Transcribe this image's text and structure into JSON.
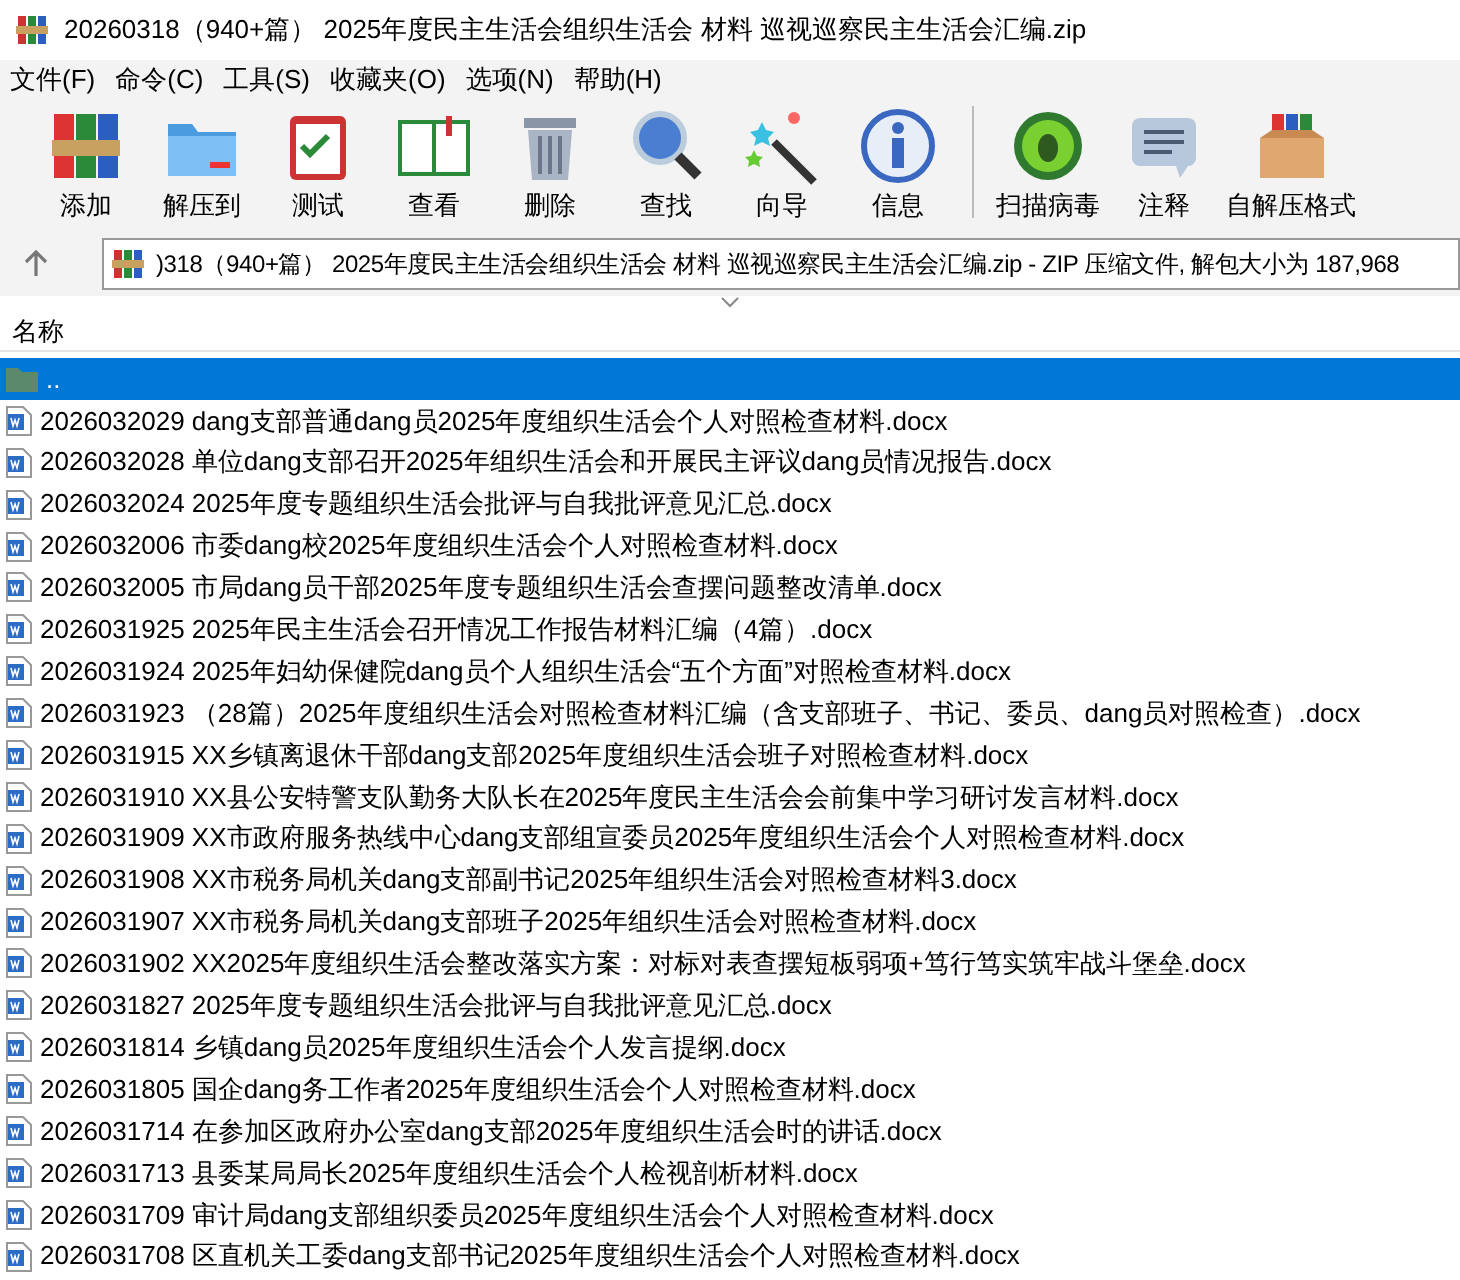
{
  "window": {
    "title": "20260318（940+篇） 2025年度民主生活会组织生活会 材料   巡视巡察民主生活会汇编.zip"
  },
  "menu": [
    "文件(F)",
    "命令(C)",
    "工具(S)",
    "收藏夹(O)",
    "选项(N)",
    "帮助(H)"
  ],
  "toolbar": [
    {
      "kind": "add",
      "label": "添加"
    },
    {
      "kind": "extract",
      "label": "解压到"
    },
    {
      "kind": "test",
      "label": "测试"
    },
    {
      "kind": "view",
      "label": "查看"
    },
    {
      "kind": "delete",
      "label": "删除"
    },
    {
      "kind": "find",
      "label": "查找"
    },
    {
      "kind": "wizard",
      "label": "向导"
    },
    {
      "kind": "info",
      "label": "信息"
    },
    {
      "kind": "separator"
    },
    {
      "kind": "scan",
      "label": "扫描病毒"
    },
    {
      "kind": "comment",
      "label": "注释"
    },
    {
      "kind": "sfx",
      "label": "自解压格式"
    }
  ],
  "address": {
    "text": ")318（940+篇） 2025年度民主生活会组织生活会 材料   巡视巡察民主生活会汇编.zip - ZIP 压缩文件, 解包大小为 187,968"
  },
  "table": {
    "columns": [
      "名称"
    ],
    "rows": [
      {
        "kind": "parent",
        "name": "..",
        "selected": true
      },
      {
        "kind": "docx",
        "name": "2026032029 dang支部普通dang员2025年度组织生活会个人对照检查材料.docx",
        "selected": false
      },
      {
        "kind": "docx",
        "name": "2026032028 单位dang支部召开2025年组织生活会和开展民主评议dang员情况报告.docx",
        "selected": false
      },
      {
        "kind": "docx",
        "name": "2026032024 2025年度专题组织生活会批评与自我批评意见汇总.docx",
        "selected": false
      },
      {
        "kind": "docx",
        "name": "2026032006 市委dang校2025年度组织生活会个人对照检查材料.docx",
        "selected": false
      },
      {
        "kind": "docx",
        "name": "2026032005 市局dang员干部2025年度专题组织生活会查摆问题整改清单.docx",
        "selected": false
      },
      {
        "kind": "docx",
        "name": "2026031925 2025年民主生活会召开情况工作报告材料汇编（4篇）.docx",
        "selected": false
      },
      {
        "kind": "docx",
        "name": "2026031924 2025年妇幼保健院dang员个人组织生活会“五个方面”对照检查材料.docx",
        "selected": false
      },
      {
        "kind": "docx",
        "name": "2026031923 （28篇）2025年度组织生活会对照检查材料汇编（含支部班子、书记、委员、dang员对照检查）.docx",
        "selected": false
      },
      {
        "kind": "docx",
        "name": "2026031915 XX乡镇离退休干部dang支部2025年度组织生活会班子对照检查材料.docx",
        "selected": false
      },
      {
        "kind": "docx",
        "name": "2026031910 XX县公安特警支队勤务大队长在2025年度民主生活会会前集中学习研讨发言材料.docx",
        "selected": false
      },
      {
        "kind": "docx",
        "name": "2026031909 XX市政府服务热线中心dang支部组宣委员2025年度组织生活会个人对照检查材料.docx",
        "selected": false
      },
      {
        "kind": "docx",
        "name": "2026031908 XX市税务局机关dang支部副书记2025年组织生活会对照检查材料3.docx",
        "selected": false
      },
      {
        "kind": "docx",
        "name": "2026031907 XX市税务局机关dang支部班子2025年组织生活会对照检查材料.docx",
        "selected": false
      },
      {
        "kind": "docx",
        "name": "2026031902 XX2025年度组织生活会整改落实方案：对标对表查摆短板弱项+笃行笃实筑牢战斗堡垒.docx",
        "selected": false
      },
      {
        "kind": "docx",
        "name": "2026031827 2025年度专题组织生活会批评与自我批评意见汇总.docx",
        "selected": false
      },
      {
        "kind": "docx",
        "name": "2026031814 乡镇dang员2025年度组织生活会个人发言提纲.docx",
        "selected": false
      },
      {
        "kind": "docx",
        "name": "2026031805 国企dang务工作者2025年度组织生活会个人对照检查材料.docx",
        "selected": false
      },
      {
        "kind": "docx",
        "name": "2026031714 在参加区政府办公室dang支部2025年度组织生活会时的讲话.docx",
        "selected": false
      },
      {
        "kind": "docx",
        "name": "2026031713 县委某局局长2025年度组织生活会个人检视剖析材料.docx",
        "selected": false
      },
      {
        "kind": "docx",
        "name": "2026031709 审计局dang支部组织委员2025年度组织生活会个人对照检查材料.docx",
        "selected": false
      },
      {
        "kind": "docx",
        "name": "2026031708 区直机关工委dang支部书记2025年度组织生活会个人对照检查材料.docx",
        "selected": false
      }
    ]
  }
}
